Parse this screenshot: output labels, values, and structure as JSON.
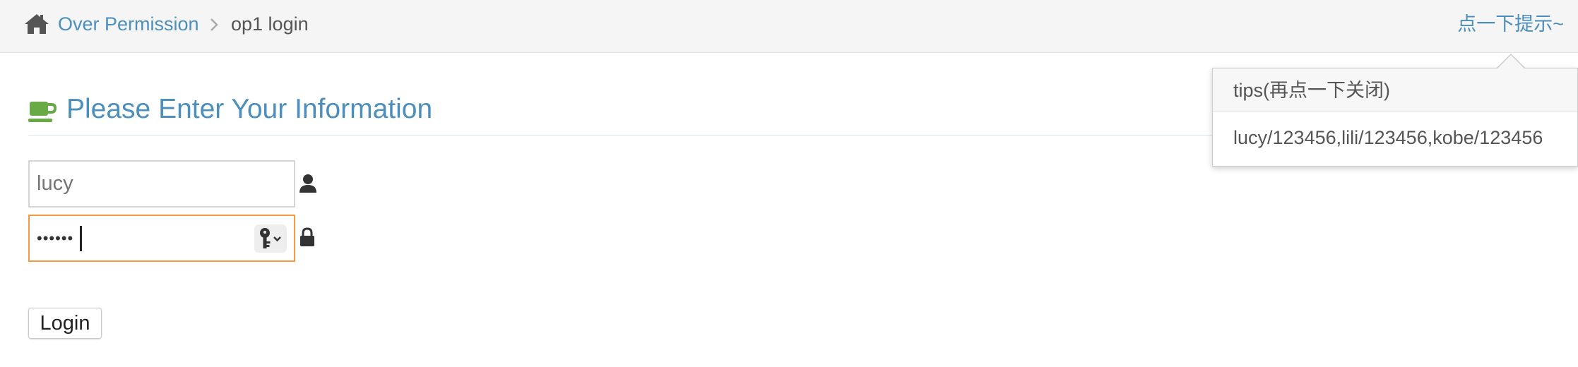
{
  "breadcrumb": {
    "home_icon": "home-icon",
    "section_label": "Over Permission",
    "separator_icon": "chevron-right-icon",
    "current_label": "op1 login"
  },
  "hint": {
    "link_label": "点一下提示~"
  },
  "header": {
    "icon": "coffee-cup-icon",
    "title": "Please Enter Your Information"
  },
  "form": {
    "username": {
      "value": "",
      "placeholder": "lucy",
      "icon": "user-icon"
    },
    "password": {
      "value": "••••••",
      "icon": "lock-icon",
      "autofill_icon": "key-icon"
    },
    "login_label": "Login"
  },
  "popover": {
    "title": "tips(再点一下关闭)",
    "content": "lucy/123456,lili/123456,kobe/123456"
  },
  "colors": {
    "link": "#4c8fbd",
    "focus_border": "#f59942",
    "cup_icon": "#69aa46"
  }
}
